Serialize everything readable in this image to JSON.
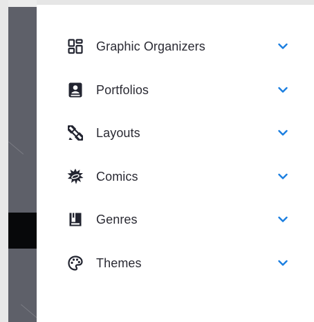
{
  "colors": {
    "text": "#2a2a33",
    "icon": "#222430",
    "accent": "#1a7ee0",
    "backdrop": "#5e6069"
  },
  "menu": {
    "items": [
      {
        "label": "Graphic Organizers",
        "icon": "graphic-organizer-icon"
      },
      {
        "label": "Portfolios",
        "icon": "portfolio-icon"
      },
      {
        "label": "Layouts",
        "icon": "layouts-icon"
      },
      {
        "label": "Comics",
        "icon": "comics-icon"
      },
      {
        "label": "Genres",
        "icon": "genres-icon"
      },
      {
        "label": "Themes",
        "icon": "themes-icon"
      }
    ],
    "expand_icon": "chevron-down-icon"
  }
}
